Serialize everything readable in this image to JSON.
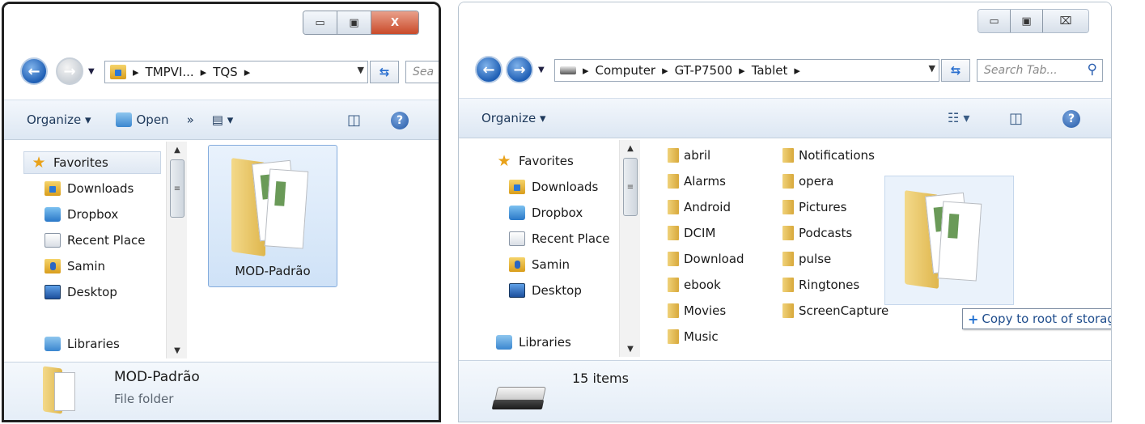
{
  "left_window": {
    "caption": {
      "minimize": "▭",
      "maximize": "▣",
      "close": "X"
    },
    "address": {
      "crumbs": [
        "TMPVI...",
        "TQS"
      ],
      "search_placeholder": "Sea"
    },
    "toolbar": {
      "organize": "Organize ▾",
      "open": "Open",
      "more": "»",
      "views": "▤ ▾"
    },
    "nav": {
      "favorites": "Favorites",
      "items": [
        "Downloads",
        "Dropbox",
        "Recent Place",
        "Samin",
        "Desktop"
      ],
      "libraries": "Libraries"
    },
    "content": {
      "selected_folder": "MOD-Padrão"
    },
    "details": {
      "name": "MOD-Padrão",
      "type": "File folder"
    }
  },
  "right_window": {
    "caption": {
      "minimize": "▭",
      "maximize": "▣",
      "close": "⌧"
    },
    "address": {
      "crumbs": [
        "Computer",
        "GT-P7500",
        "Tablet"
      ],
      "search_placeholder": "Search Tab..."
    },
    "toolbar": {
      "organize": "Organize ▾",
      "views": "☷ ▾"
    },
    "nav": {
      "favorites": "Favorites",
      "items": [
        "Downloads",
        "Dropbox",
        "Recent Place",
        "Samin",
        "Desktop"
      ],
      "libraries": "Libraries"
    },
    "content": {
      "column1": [
        "abril",
        "Alarms",
        "Android",
        "DCIM",
        "Download",
        "ebook",
        "Movies",
        "Music"
      ],
      "column2": [
        "Notifications",
        "opera",
        "Pictures",
        "Podcasts",
        "pulse",
        "Ringtones",
        "ScreenCapture"
      ],
      "drag_tooltip": "Copy to root of storage"
    },
    "details": {
      "count": "15 items"
    }
  }
}
